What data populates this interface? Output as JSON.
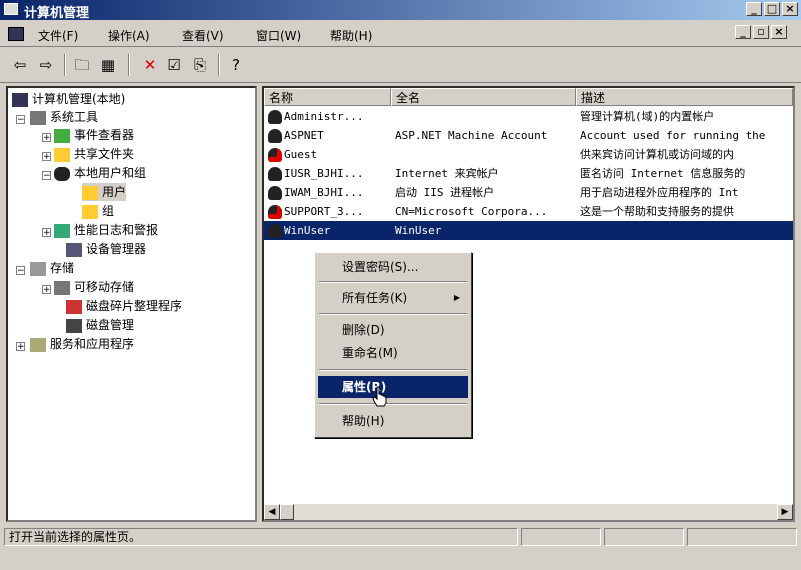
{
  "window": {
    "title": "计算机管理"
  },
  "menu": [
    "文件(F)",
    "操作(A)",
    "查看(V)",
    "窗口(W)",
    "帮助(H)"
  ],
  "toolbar": {
    "icons": [
      "back-icon",
      "forward-icon",
      "up-folder-icon",
      "show-tree-icon",
      "delete-icon",
      "properties-icon",
      "export-icon",
      "help-icon"
    ]
  },
  "tree": {
    "root": "计算机管理(本地)",
    "system_tools": "系统工具",
    "event_viewer": "事件查看器",
    "shared_folders": "共享文件夹",
    "local_users_groups": "本地用户和组",
    "users": "用户",
    "groups": "组",
    "perf_logs": "性能日志和警报",
    "device_manager": "设备管理器",
    "storage": "存储",
    "removable_storage": "可移动存储",
    "defrag": "磁盘碎片整理程序",
    "disk_mgmt": "磁盘管理",
    "services_apps": "服务和应用程序"
  },
  "list": {
    "columns": [
      "名称",
      "全名",
      "描述"
    ],
    "rows": [
      {
        "name": "Administr...",
        "fullname": "",
        "desc": "管理计算机(域)的内置帐户",
        "disabled": false
      },
      {
        "name": "ASPNET",
        "fullname": "ASP.NET Machine Account",
        "desc": "Account used for running the",
        "disabled": false
      },
      {
        "name": "Guest",
        "fullname": "",
        "desc": "供来宾访问计算机或访问域的内",
        "disabled": true
      },
      {
        "name": "IUSR_BJHI...",
        "fullname": "Internet 来宾帐户",
        "desc": "匿名访问 Internet 信息服务的",
        "disabled": false
      },
      {
        "name": "IWAM_BJHI...",
        "fullname": "启动 IIS 进程帐户",
        "desc": "用于启动进程外应用程序的 Int",
        "disabled": false
      },
      {
        "name": "SUPPORT_3...",
        "fullname": "CN=Microsoft Corpora...",
        "desc": "这是一个帮助和支持服务的提供",
        "disabled": true
      },
      {
        "name": "WinUser",
        "fullname": "WinUser",
        "desc": "",
        "disabled": false
      }
    ]
  },
  "context_menu": {
    "set_password": "设置密码(S)...",
    "all_tasks": "所有任务(K)",
    "delete": "删除(D)",
    "rename": "重命名(M)",
    "properties": "属性(R)",
    "help": "帮助(H)"
  },
  "status": {
    "text": "打开当前选择的属性页。"
  }
}
